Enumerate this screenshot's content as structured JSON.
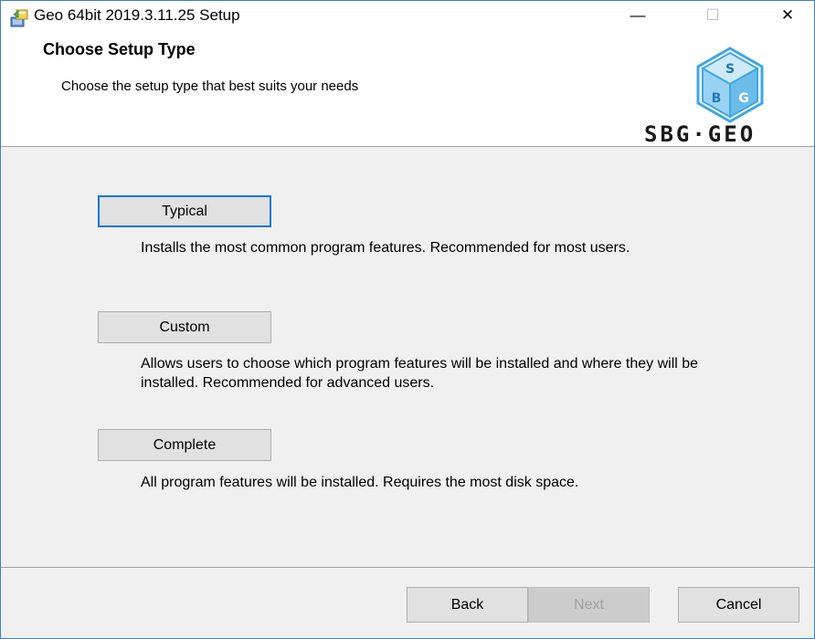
{
  "window": {
    "title": "Geo 64bit 2019.3.11.25 Setup",
    "controls": {
      "minimize": "—",
      "maximize": "☐",
      "close": "✕"
    },
    "icon": "installer-icon"
  },
  "header": {
    "title": "Choose Setup Type",
    "subtitle": "Choose the setup type that best suits your needs",
    "logo_text": "SBG·GEO",
    "logo_icon": "sbg-geo-logo-icon"
  },
  "options": [
    {
      "label": "Typical",
      "description": "Installs the most common program features. Recommended for most users."
    },
    {
      "label": "Custom",
      "description": "Allows users to choose which program features will be installed and where they will be installed. Recommended for advanced users."
    },
    {
      "label": "Complete",
      "description": "All program features will be installed. Requires the most disk space."
    }
  ],
  "footer": {
    "back_label": "Back",
    "next_label": "Next",
    "cancel_label": "Cancel"
  },
  "colors": {
    "focus_border": "#0078d7",
    "window_border": "#3c82c8",
    "logo_blue": "#3fa7e3"
  }
}
